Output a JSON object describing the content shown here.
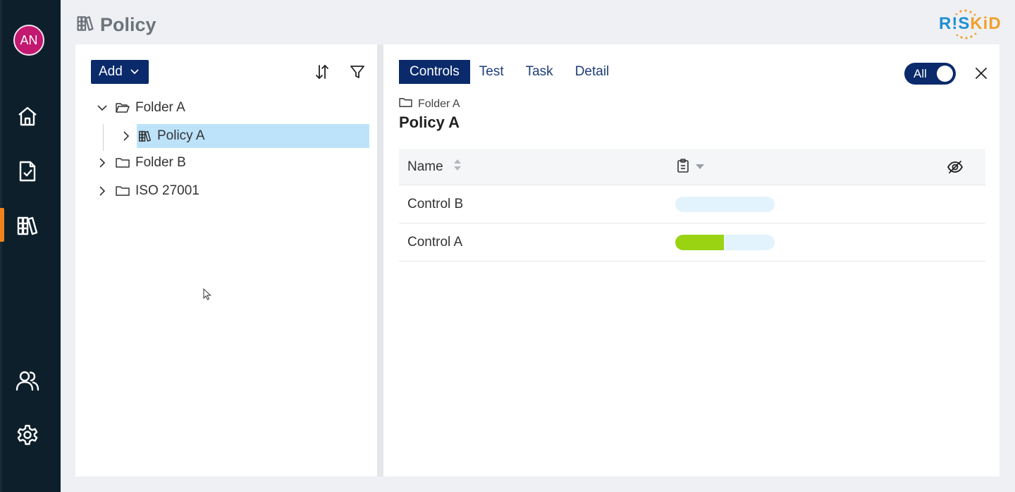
{
  "header": {
    "title": "Policy",
    "logo_part1": "R!S",
    "logo_part2": "KiD"
  },
  "rail": {
    "avatar_initials": "AN",
    "items": [
      {
        "icon": "home-icon"
      },
      {
        "icon": "task-check-icon"
      },
      {
        "icon": "library-icon",
        "active": true
      },
      {
        "icon": "users-icon"
      },
      {
        "icon": "gear-icon"
      }
    ]
  },
  "left_panel": {
    "add_label": "Add",
    "tree": [
      {
        "label": "Folder A",
        "expanded": true
      },
      {
        "label": "Policy A",
        "selected": true
      },
      {
        "label": "Folder B"
      },
      {
        "label": "ISO 27001"
      }
    ]
  },
  "right_panel": {
    "tabs": [
      "Controls",
      "Test",
      "Task",
      "Detail"
    ],
    "active_tab": "Controls",
    "toggle_label": "All",
    "breadcrumb": "Folder A",
    "title": "Policy A",
    "table": {
      "column_name": "Name",
      "rows": [
        {
          "name": "Control B",
          "progress": 0
        },
        {
          "name": "Control A",
          "progress": 0.49
        }
      ]
    }
  },
  "colors": {
    "rail_bg": "#0d1f2b",
    "accent_navy": "#0a2a6b",
    "active_marker": "#f0841c",
    "selection": "#bde3fb",
    "progress_fill": "#99d311",
    "progress_track": "#e3f3fd",
    "avatar": "#c2186f"
  }
}
